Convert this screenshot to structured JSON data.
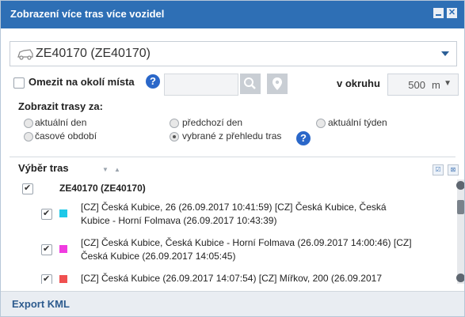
{
  "window": {
    "title": "Zobrazení více tras více vozidel",
    "title_color": "#2e6fb5"
  },
  "vehicle_select": {
    "value": "ZE40170 (ZE40170)",
    "icon": "car-icon"
  },
  "limit": {
    "label": "Omezit na okolí místa",
    "checked": false,
    "help": "?",
    "search_value": "",
    "search_icon": "search-icon",
    "pin_icon": "map-pin-icon",
    "radius_label": "v okruhu",
    "radius_value": "500",
    "radius_unit": "m"
  },
  "show_routes": {
    "heading": "Zobrazit trasy za:",
    "options": [
      {
        "label": "aktuální den",
        "selected": false
      },
      {
        "label": "předchozí den",
        "selected": false
      },
      {
        "label": "aktuální týden",
        "selected": false
      },
      {
        "label": "časové období",
        "selected": false
      },
      {
        "label": "vybrané z přehledu tras",
        "selected": true
      }
    ],
    "help": "?"
  },
  "route_select": {
    "heading": "Výběr tras",
    "vehicle_row": {
      "label": "ZE40170 (ZE40170)",
      "checked": true
    },
    "routes": [
      {
        "color": "#1ec8e8",
        "checked": true,
        "line1": "[CZ] Česká Kubice, 26 (26.09.2017 10:41:59) [CZ] Česká Kubice, Česká",
        "line2": "Kubice - Horní Folmava (26.09.2017 10:43:39)"
      },
      {
        "color": "#f03ce0",
        "checked": true,
        "line1": "[CZ] Česká Kubice, Česká Kubice - Horní Folmava (26.09.2017 14:00:46) [CZ]",
        "line2": "Česká Kubice (26.09.2017 14:05:45)"
      },
      {
        "color": "#f05050",
        "checked": true,
        "line1": "[CZ] Česká Kubice (26.09.2017 14:07:54) [CZ] Mířkov, 200 (26.09.2017",
        "line2": ""
      }
    ]
  },
  "footer": {
    "export_label": "Export KML"
  }
}
